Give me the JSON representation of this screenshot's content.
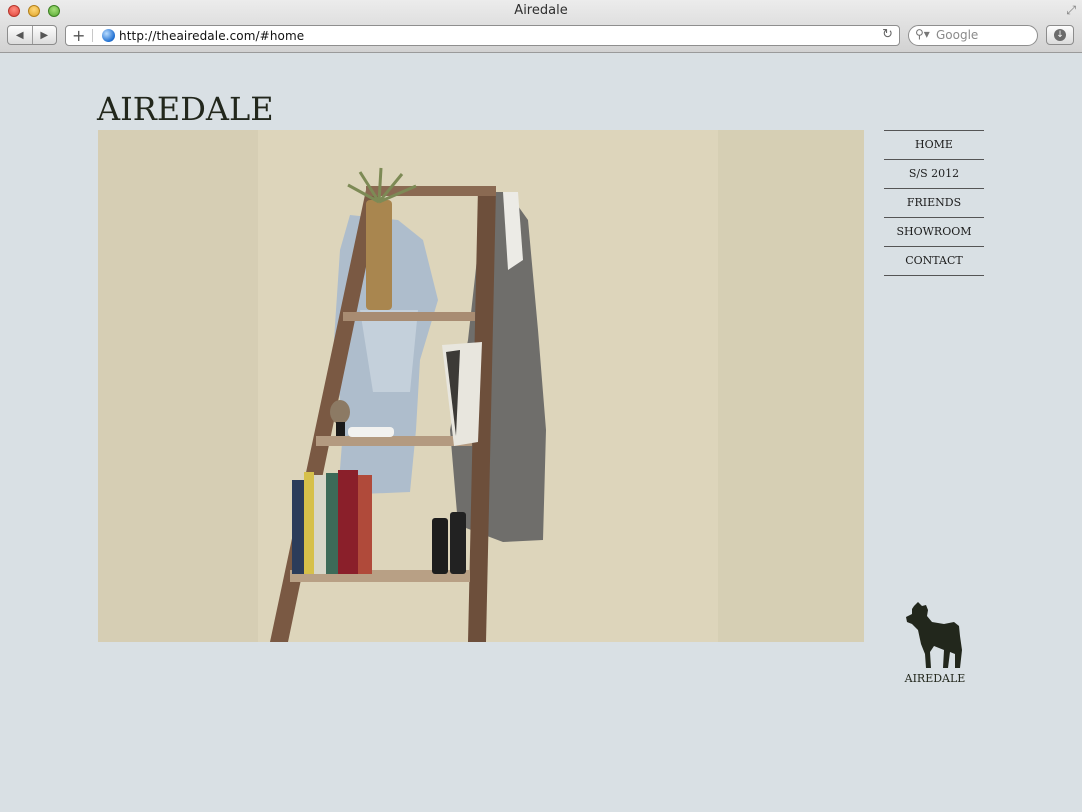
{
  "window": {
    "title": "Airedale",
    "url": "http://theairedale.com/#home",
    "search_placeholder": "Google"
  },
  "site": {
    "logo": "AIREDALE",
    "hero_image": "ladder-still-life",
    "nav": [
      {
        "label": "HOME"
      },
      {
        "label": "S/S 2012"
      },
      {
        "label": "FRIENDS"
      },
      {
        "label": "SHOWROOM"
      },
      {
        "label": "CONTACT"
      }
    ],
    "footer_logo_text": "AIREDALE",
    "footer_icon": "airedale-dog-icon"
  },
  "colors": {
    "page_bg": "#d9e0e4",
    "ink": "#22271c",
    "menu_rule": "#555555"
  }
}
